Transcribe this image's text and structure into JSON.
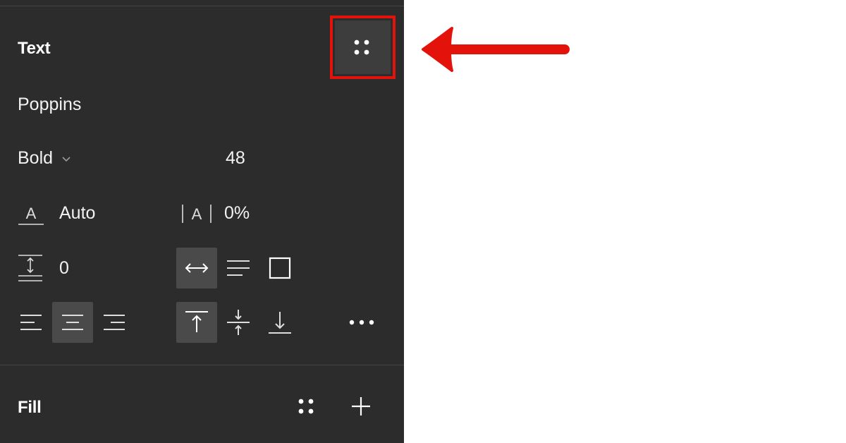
{
  "text_section": {
    "title": "Text",
    "font_family": "Poppins",
    "font_weight": "Bold",
    "font_size": "48",
    "line_height_value": "Auto",
    "letter_spacing_value": "0%",
    "paragraph_spacing_value": "0"
  },
  "fill_section": {
    "title": "Fill"
  },
  "colors": {
    "panel_background": "#2c2c2c",
    "active_button": "#4a4a4a",
    "highlight": "#e3120b"
  },
  "icons": {
    "styles": "four-dots-icon",
    "auto_width": "double-arrow-horizontal-icon",
    "auto_height": "lines-icon",
    "fixed_size": "square-icon",
    "align_left": "align-left-icon",
    "align_center": "align-center-icon",
    "align_right": "align-right-icon",
    "align_top": "align-top-icon",
    "align_middle": "align-middle-icon",
    "align_bottom": "align-bottom-icon",
    "more": "ellipsis-icon",
    "add": "plus-icon"
  },
  "annotation": {
    "arrow_direction": "left",
    "highlighted_element": "text-styles-button"
  }
}
